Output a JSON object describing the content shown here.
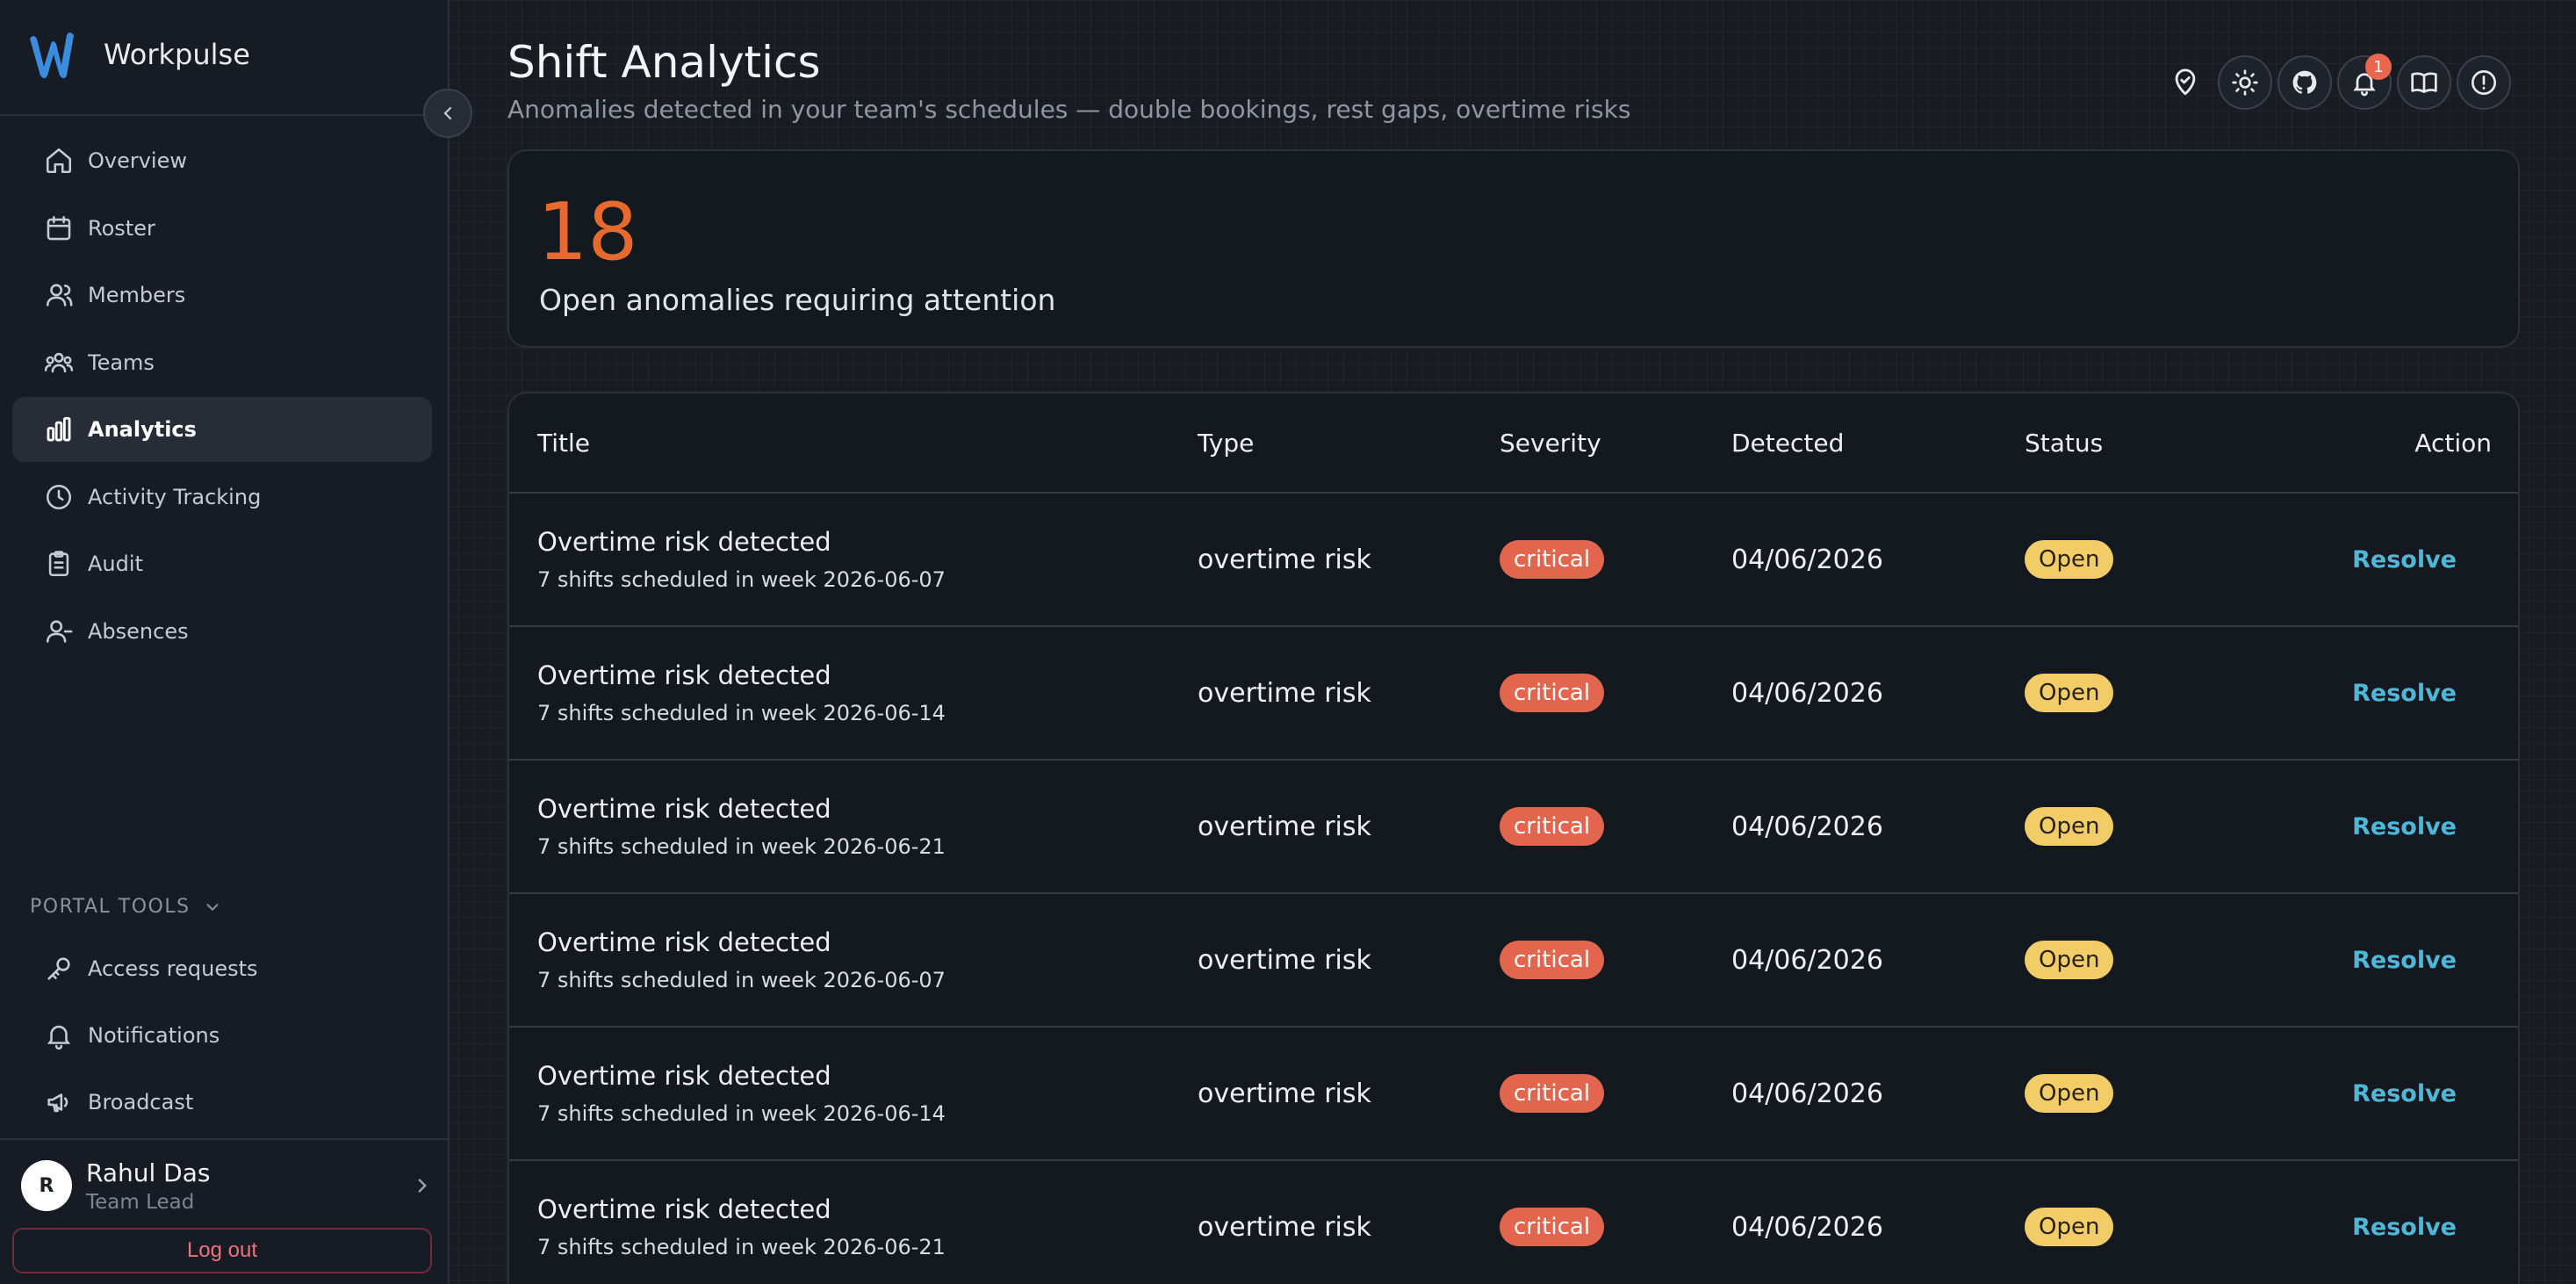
{
  "app": {
    "name": "Workpulse"
  },
  "sidebar": {
    "items": [
      {
        "label": "Overview",
        "icon": "home-icon",
        "active": false
      },
      {
        "label": "Roster",
        "icon": "calendar-icon",
        "active": false
      },
      {
        "label": "Members",
        "icon": "members-icon",
        "active": false
      },
      {
        "label": "Teams",
        "icon": "teams-icon",
        "active": false
      },
      {
        "label": "Analytics",
        "icon": "bar-chart-icon",
        "active": true
      },
      {
        "label": "Activity Tracking",
        "icon": "clock-icon",
        "active": false
      },
      {
        "label": "Audit",
        "icon": "clipboard-icon",
        "active": false
      },
      {
        "label": "Absences",
        "icon": "user-minus-icon",
        "active": false
      }
    ],
    "portal_tools_label": "PORTAL TOOLS",
    "tools": [
      {
        "label": "Access requests",
        "icon": "key-icon"
      },
      {
        "label": "Notifications",
        "icon": "bell-icon"
      },
      {
        "label": "Broadcast",
        "icon": "megaphone-icon"
      }
    ],
    "user": {
      "initial": "R",
      "name": "Rahul Das",
      "role": "Team Lead"
    },
    "logout_label": "Log out"
  },
  "header": {
    "title": "Shift Analytics",
    "subtitle": "Anomalies detected in your team's schedules — double bookings, rest gaps, overtime risks",
    "notification_count": "1",
    "toolbar_icons": [
      "location-pin-icon",
      "sun-icon",
      "github-icon",
      "bell-icon",
      "book-icon",
      "alert-circle-icon"
    ]
  },
  "stat": {
    "value": "18",
    "label": "Open anomalies requiring attention"
  },
  "table": {
    "columns": {
      "title": "Title",
      "type": "Type",
      "severity": "Severity",
      "detected": "Detected",
      "status": "Status",
      "action": "Action"
    },
    "rows": [
      {
        "title": "Overtime risk detected",
        "subtitle": "7 shifts scheduled in week 2026-06-07",
        "type": "overtime risk",
        "severity": "critical",
        "detected": "04/06/2026",
        "status": "Open",
        "action": "Resolve"
      },
      {
        "title": "Overtime risk detected",
        "subtitle": "7 shifts scheduled in week 2026-06-14",
        "type": "overtime risk",
        "severity": "critical",
        "detected": "04/06/2026",
        "status": "Open",
        "action": "Resolve"
      },
      {
        "title": "Overtime risk detected",
        "subtitle": "7 shifts scheduled in week 2026-06-21",
        "type": "overtime risk",
        "severity": "critical",
        "detected": "04/06/2026",
        "status": "Open",
        "action": "Resolve"
      },
      {
        "title": "Overtime risk detected",
        "subtitle": "7 shifts scheduled in week 2026-06-07",
        "type": "overtime risk",
        "severity": "critical",
        "detected": "04/06/2026",
        "status": "Open",
        "action": "Resolve"
      },
      {
        "title": "Overtime risk detected",
        "subtitle": "7 shifts scheduled in week 2026-06-14",
        "type": "overtime risk",
        "severity": "critical",
        "detected": "04/06/2026",
        "status": "Open",
        "action": "Resolve"
      },
      {
        "title": "Overtime risk detected",
        "subtitle": "7 shifts scheduled in week 2026-06-21",
        "type": "overtime risk",
        "severity": "critical",
        "detected": "04/06/2026",
        "status": "Open",
        "action": "Resolve"
      }
    ]
  },
  "colors": {
    "accent_orange": "#e8692e",
    "critical_badge": "#e2664d",
    "open_badge": "#f2cc67",
    "resolve_link": "#4fb7d8",
    "logo_blue": "#3a8dde"
  }
}
